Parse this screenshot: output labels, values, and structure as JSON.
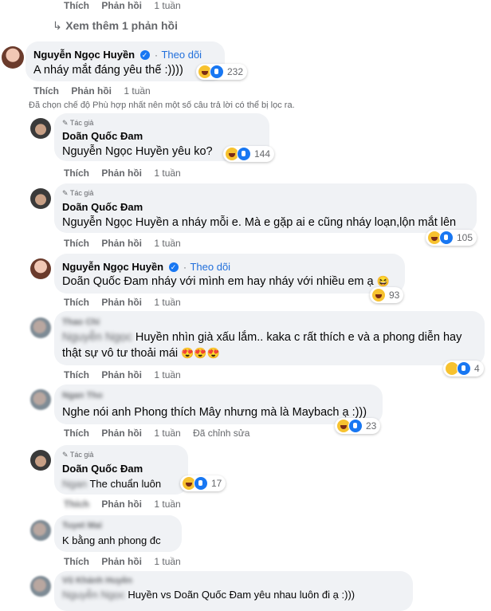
{
  "top_actions": {
    "like": "Thích",
    "reply": "Phản hồi",
    "time": "1 tuần"
  },
  "see_more": "Xem thêm 1 phản hồi",
  "notice": "Đã chọn chế độ Phù hợp nhất nên một số câu trả lời có thể bị lọc ra.",
  "comments": [
    {
      "author": "Nguyễn Ngọc Huyền",
      "follow": "Theo dõi",
      "text": "A nháy mắt đáng yêu thế :))))",
      "reactions": "232",
      "like": "Thích",
      "reply": "Phản hồi",
      "time": "1 tuần"
    },
    {
      "badge": "Tác giả",
      "author": "Doãn Quốc Đam",
      "text": "Nguyễn Ngọc Huyền yêu ko?",
      "reactions": "144",
      "like": "Thích",
      "reply": "Phản hồi",
      "time": "1 tuần"
    },
    {
      "badge": "Tác giả",
      "author": "Doãn Quốc Đam",
      "text": "Nguyễn Ngọc Huyền a nháy mỗi e. Mà e gặp ai e cũng nháy loạn,lộn mắt lên",
      "reactions": "105",
      "like": "Thích",
      "reply": "Phản hồi",
      "time": "1 tuần"
    },
    {
      "author": "Nguyễn Ngọc Huyền",
      "follow": "Theo dõi",
      "text": "Doãn Quốc Đam nháy với mình em hay nháy với nhiều em ạ",
      "reactions": "93",
      "like": "Thích",
      "reply": "Phản hồi",
      "time": "1 tuần"
    },
    {
      "author": "Thao Chi",
      "text_blur": "Nguyễn Ngọc",
      "text": "Huyền nhìn già xấu lắm.. kaka c rất thích e và a phong diễn hay",
      "text2": "thật sự vô tư thoải mái",
      "reactions": "4",
      "like": "Thích",
      "reply": "Phản hồi",
      "time": "1 tuần"
    },
    {
      "author": "Ngan Tho",
      "text": "Nghe nói anh Phong thích Mây nhưng mà là Maybach ạ :)))",
      "reactions": "23",
      "like": "Thích",
      "reply": "Phản hồi",
      "time": "1 tuần",
      "edited": "Đã chỉnh sửa"
    },
    {
      "badge": "Tác giả",
      "author": "Doãn Quốc Đam",
      "text_blur": "Ngan",
      "text": "The chuẩn luôn",
      "reactions": "17",
      "like": "Thích",
      "reply": "Phản hồi",
      "time": "1 tuần"
    },
    {
      "author": "Tuyet Mai",
      "text": "K bằng anh phong đc",
      "like": "Thích",
      "reply": "Phản hồi",
      "time": "1 tuần"
    },
    {
      "author": "Vũ Khánh Huyền",
      "text_blur": "Nguyễn Ngọc",
      "text": "Huyền vs Doãn Quốc Đam yêu nhau luôn đi ạ :)))"
    }
  ],
  "colors": {
    "bubble": "#f0f2f5",
    "link": "#216fdb",
    "meta": "#65676b",
    "like": "#1877f2",
    "haha": "#f7c22f"
  }
}
